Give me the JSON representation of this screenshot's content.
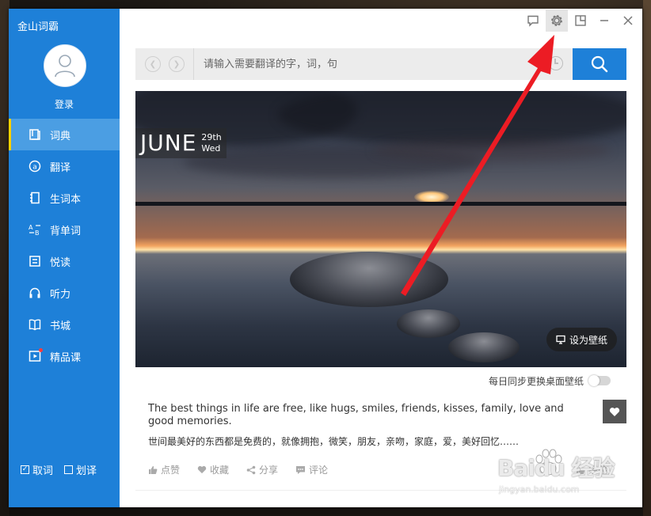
{
  "app": {
    "title": "金山词霸"
  },
  "user": {
    "login_label": "登录"
  },
  "sidebar": {
    "items": [
      {
        "label": "词典",
        "icon": "dictionary-icon",
        "active": true
      },
      {
        "label": "翻译",
        "icon": "translate-icon",
        "active": false
      },
      {
        "label": "生词本",
        "icon": "wordbook-icon",
        "active": false
      },
      {
        "label": "背单词",
        "icon": "flashcards-icon",
        "active": false
      },
      {
        "label": "悦读",
        "icon": "reading-icon",
        "active": false
      },
      {
        "label": "听力",
        "icon": "headphones-icon",
        "active": false
      },
      {
        "label": "书城",
        "icon": "book-store-icon",
        "active": false
      },
      {
        "label": "精品课",
        "icon": "course-icon",
        "active": false,
        "badge": true
      }
    ],
    "options": [
      {
        "label": "取词",
        "checked": true
      },
      {
        "label": "划译",
        "checked": false
      }
    ]
  },
  "search": {
    "placeholder": "请输入需要翻译的字，词，句"
  },
  "wallpaper": {
    "month": "JUNE",
    "day": "29th",
    "weekday": "Wed",
    "set_wallpaper_label": "设为壁纸",
    "sync_label": "每日同步更换桌面壁纸",
    "sync_enabled": false
  },
  "quote": {
    "en": "The best things in life are free, like hugs, smiles, friends, kisses, family, love and good memories.",
    "cn": "世间最美好的东西都是免费的，就像拥抱，微笑，朋友，亲吻，家庭，爱，美好回忆……"
  },
  "actions": {
    "like": "点赞",
    "collect": "收藏",
    "share": "分享",
    "comment": "评论",
    "right": "经验"
  },
  "watermark": {
    "main": "Baidu 经验",
    "sub": "jingyan.baidu.com"
  },
  "colors": {
    "brand": "#1e80d8",
    "active_nav": "#4b9ee3",
    "indicator": "#ffd200",
    "arrow": "#ec1c24"
  }
}
